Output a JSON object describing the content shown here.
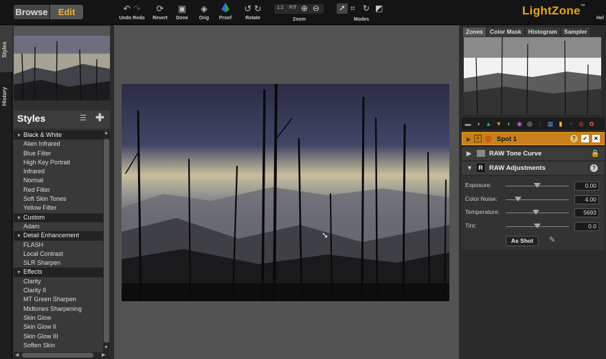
{
  "toolbar": {
    "browse": "Browse",
    "edit": "Edit",
    "undo_redo": "Undo Redo",
    "revert": "Revert",
    "done": "Done",
    "orig": "Orig",
    "proof": "Proof",
    "rotate": "Rotate",
    "zoom_1to1": "1:1",
    "zoom_fit": "FIT",
    "zoom": "Zoom",
    "modes": "Modes",
    "brand": "LightZone",
    "brand_mark": "™",
    "help": "Hel"
  },
  "left_tabs": {
    "styles": "Styles",
    "history": "History"
  },
  "styles_panel": {
    "title": "Styles",
    "groups": [
      {
        "name": "Black & White",
        "items": [
          "Alien Infrared",
          "Blue Filter",
          "High Key Portrait",
          "Infrared",
          "Normal",
          "Red Filter",
          "Soft Skin Tones",
          "Yellow Filter"
        ]
      },
      {
        "name": "Custom",
        "items": [
          "Adam"
        ]
      },
      {
        "name": "Detail Enhancement",
        "items": [
          "FLASH",
          "Local Contrast",
          "SLR Sharpen"
        ]
      },
      {
        "name": "Effects",
        "items": [
          "Clarity",
          "Clarity II",
          "MT Green Sharpen",
          "Midtones Sharpening",
          "Skin Glow",
          "Skin Glow II",
          "Skin Glow III",
          "Soften Skin"
        ]
      }
    ]
  },
  "right_tabs": [
    "Zones",
    "Color Mask",
    "Histogram",
    "Sampler"
  ],
  "layers": {
    "spot": "Spot 1",
    "tone_curve": "RAW Tone Curve",
    "raw_adjust": "RAW Adjustments",
    "raw_badge": "R"
  },
  "adjustments": [
    {
      "label": "Exposure:",
      "value": "0.00",
      "level": 0.5
    },
    {
      "label": "Color Noise:",
      "value": "4.00",
      "level": 0.2
    },
    {
      "label": "Temperature:",
      "value": "5693",
      "level": 0.48
    },
    {
      "label": "Tint:",
      "value": "0.0",
      "level": 0.5
    }
  ],
  "as_shot": "As Shot",
  "colors": {
    "accent": "#e7a51f",
    "spot_layer": "#c9801c",
    "edit_active": "#f0b030"
  },
  "icons": [
    "undo-icon",
    "redo-icon",
    "revert-icon",
    "done-icon",
    "orig-icon",
    "proof-icon",
    "rotate-left-icon",
    "rotate-right-icon",
    "zoom-in-icon",
    "zoom-out-icon",
    "arrow-mode-icon",
    "crop-mode-icon",
    "rotate-mode-icon",
    "region-mode-icon"
  ]
}
